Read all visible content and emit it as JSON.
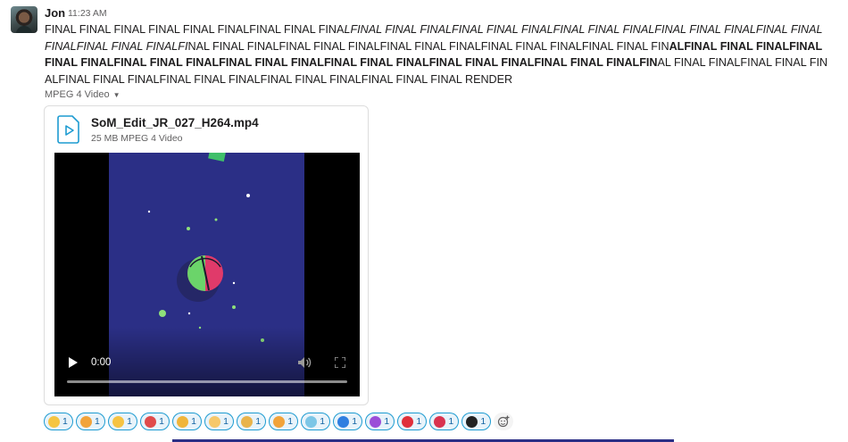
{
  "message": {
    "author": "Jon",
    "time": "11:23 AM",
    "text_parts": [
      {
        "style": "normal",
        "text": "FINAL FINAL FINAL FINAL FINAL FINALFINAL FINAL FINA"
      },
      {
        "style": "italic",
        "text": "LFINAL FINAL FINALFINAL FINAL FINALFINAL FINAL FINALFINAL FINAL FINALFINAL FINAL FINALFINAL FINAL FINALFI"
      },
      {
        "style": "normal",
        "text": "NAL FINAL FINALFINAL FINAL FINALFINAL FINAL FINALFINAL FINAL FINALFINAL FINAL FIN"
      },
      {
        "style": "bold",
        "text": "ALFINAL FINAL FINALFINAL FINAL FINALFINAL FINAL FINALFINAL FINAL FINALFINAL FINAL FINALFINAL FINAL FINALFINAL FINAL FINALFIN"
      },
      {
        "style": "normal",
        "text": "AL FINAL FINALFINAL FINAL FINALFINAL FINAL FINALFINAL FINAL FINALFINAL FINAL FINALFINAL FINAL FINAL RENDER"
      }
    ]
  },
  "attachment": {
    "type_label": "MPEG 4 Video",
    "file_name": "SoM_Edit_JR_027_H264.mp4",
    "file_meta": "25 MB MPEG 4 Video",
    "current_time": "0:00"
  },
  "reactions": [
    {
      "name": "ok-hand",
      "color": "#f5c542",
      "count": "1"
    },
    {
      "name": "cat-face",
      "color": "#f2a33a",
      "count": "1"
    },
    {
      "name": "heart-eyes",
      "color": "#f6c342",
      "count": "1"
    },
    {
      "name": "mushroom",
      "color": "#e04b4b",
      "count": "1"
    },
    {
      "name": "crowned-face",
      "color": "#f0b53a",
      "count": "1"
    },
    {
      "name": "flushed-face",
      "color": "#f6c86a",
      "count": "1"
    },
    {
      "name": "nerd-face",
      "color": "#e9b34a",
      "count": "1"
    },
    {
      "name": "cat-smile",
      "color": "#f2a33a",
      "count": "1"
    },
    {
      "name": "party-popper",
      "color": "#7cc6e6",
      "count": "1"
    },
    {
      "name": "blue-heart",
      "color": "#2f7fe0",
      "count": "1"
    },
    {
      "name": "purple-heart",
      "color": "#9b4ed8",
      "count": "1"
    },
    {
      "name": "red-heart",
      "color": "#e0303a",
      "count": "1"
    },
    {
      "name": "hibiscus",
      "color": "#d9334f",
      "count": "1"
    },
    {
      "name": "black-heart",
      "color": "#222222",
      "count": "1"
    }
  ],
  "colors": {
    "reaction_bg": "#e8f3fa",
    "reaction_border": "#1d9bd1",
    "video_bg": "#2b2f86"
  }
}
